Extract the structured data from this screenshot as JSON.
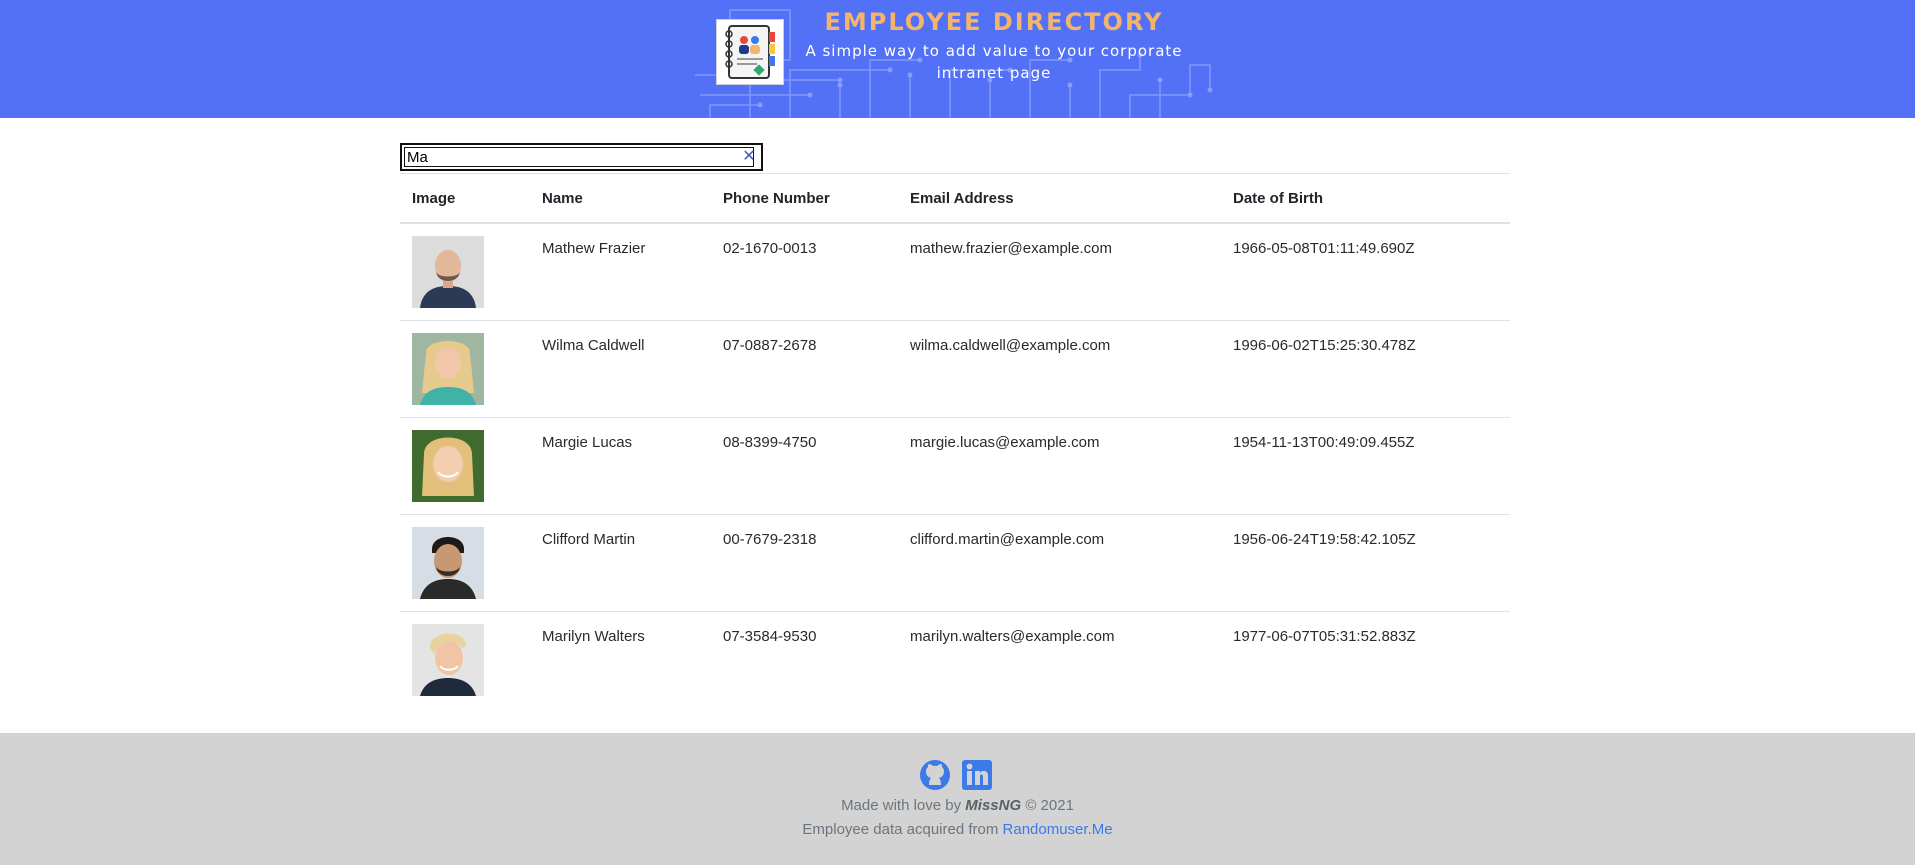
{
  "header": {
    "title": "EMPLOYEE DIRECTORY",
    "tagline": "A simple way to add value to your corporate intranet page",
    "logo_icon": "address-book-icon",
    "background_color": "#5371f7",
    "title_color": "#f6b36a"
  },
  "search": {
    "value": "Ma",
    "clear_icon": "close-icon"
  },
  "table": {
    "headers": [
      "Image",
      "Name",
      "Phone Number",
      "Email Address",
      "Date of Birth"
    ],
    "rows": [
      {
        "name": "Mathew Frazier",
        "phone": "02-1670-0013",
        "email": "mathew.frazier@example.com",
        "dob": "1966-05-08T01:11:49.690Z"
      },
      {
        "name": "Wilma Caldwell",
        "phone": "07-0887-2678",
        "email": "wilma.caldwell@example.com",
        "dob": "1996-06-02T15:25:30.478Z"
      },
      {
        "name": "Margie Lucas",
        "phone": "08-8399-4750",
        "email": "margie.lucas@example.com",
        "dob": "1954-11-13T00:49:09.455Z"
      },
      {
        "name": "Clifford Martin",
        "phone": "00-7679-2318",
        "email": "clifford.martin@example.com",
        "dob": "1956-06-24T19:58:42.105Z"
      },
      {
        "name": "Marilyn Walters",
        "phone": "07-3584-9530",
        "email": "marilyn.walters@example.com",
        "dob": "1977-06-07T05:31:52.883Z"
      }
    ]
  },
  "footer": {
    "made_with": "Made with love by",
    "author": "MissNG",
    "copyright": "© 2021",
    "data_source_text": "Employee data acquired from",
    "data_source_link": "Randomuser.Me",
    "icons": [
      "github-icon",
      "linkedin-icon"
    ],
    "background_color": "#d3d3d3",
    "link_color": "#3b7ae8"
  }
}
